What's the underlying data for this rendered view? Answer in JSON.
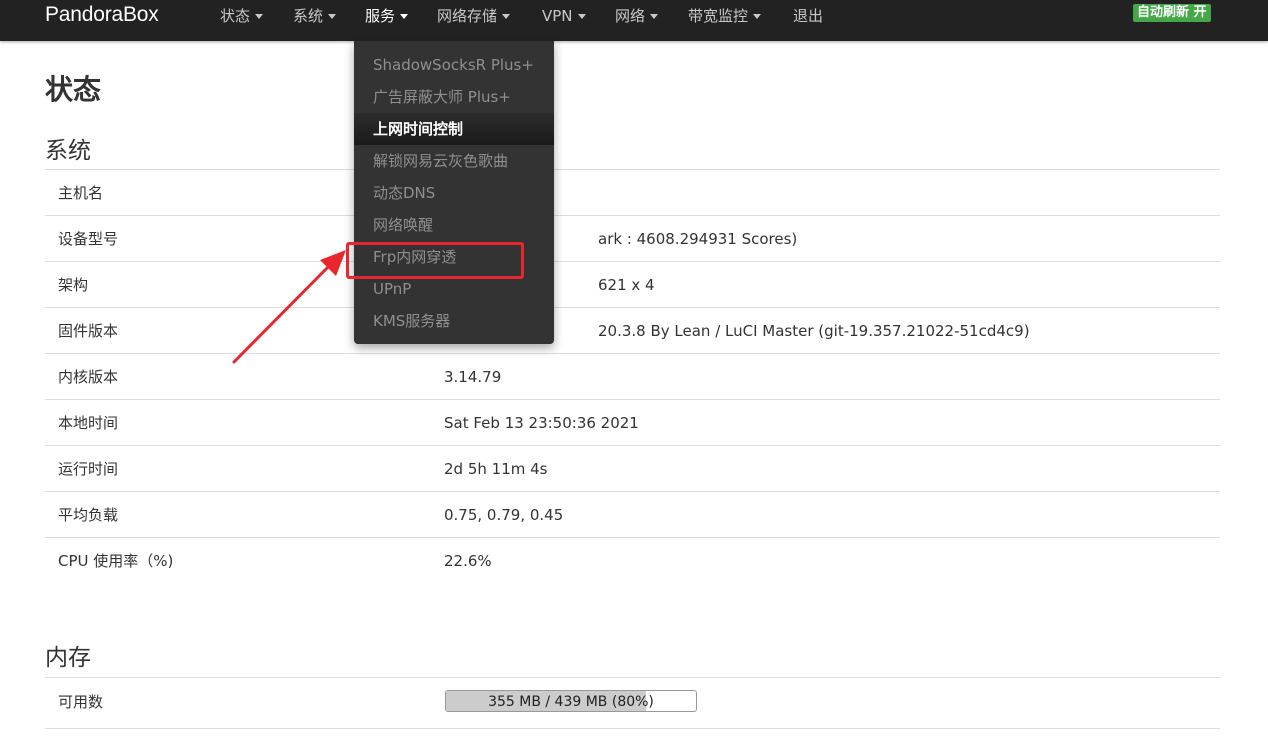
{
  "navbar": {
    "brand": "PandoraBox",
    "items": [
      {
        "label": "状态",
        "has_caret": true
      },
      {
        "label": "系统",
        "has_caret": true
      },
      {
        "label": "服务",
        "has_caret": true
      },
      {
        "label": "网络存储",
        "has_caret": true
      },
      {
        "label": "VPN",
        "has_caret": true
      },
      {
        "label": "网络",
        "has_caret": true
      },
      {
        "label": "带宽监控",
        "has_caret": true
      },
      {
        "label": "退出",
        "has_caret": false
      }
    ],
    "auto_refresh": "自动刷新 开",
    "auto_refresh_color": "#44a848"
  },
  "services_menu": {
    "items": [
      {
        "label": "ShadowSocksR Plus+"
      },
      {
        "label": "广告屏蔽大师 Plus+"
      },
      {
        "label": "上网时间控制",
        "active": true
      },
      {
        "label": "解锁网易云灰色歌曲"
      },
      {
        "label": "动态DNS"
      },
      {
        "label": "网络唤醒"
      },
      {
        "label": "Frp内网穿透",
        "highlighted": true
      },
      {
        "label": "UPnP"
      },
      {
        "label": "KMS服务器"
      }
    ],
    "highlight_color": "#e8262e"
  },
  "page": {
    "title": "状态",
    "system": {
      "heading": "系统",
      "rows": [
        {
          "label": "主机名",
          "value": ""
        },
        {
          "label": "设备型号",
          "value": "ark : 4608.294931 Scores)"
        },
        {
          "label": "架构",
          "value": "621 x 4"
        },
        {
          "label": "固件版本",
          "value": "20.3.8 By Lean / LuCI Master (git-19.357.21022-51cd4c9)"
        },
        {
          "label": "内核版本",
          "value": "3.14.79"
        },
        {
          "label": "本地时间",
          "value": "Sat Feb 13 23:50:36 2021"
        },
        {
          "label": "运行时间",
          "value": "2d 5h 11m 4s"
        },
        {
          "label": "平均负载",
          "value": "0.75, 0.79, 0.45"
        },
        {
          "label": "CPU 使用率（%)",
          "value": "22.6%"
        }
      ]
    },
    "memory": {
      "heading": "内存",
      "available_label": "可用数",
      "available_text": "355 MB / 439 MB (80%)",
      "available_percent": 80
    }
  }
}
